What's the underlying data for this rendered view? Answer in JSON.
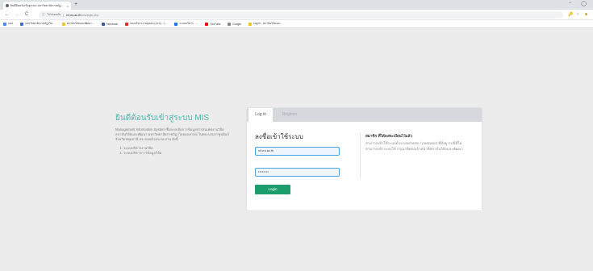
{
  "browser": {
    "tab": {
      "title": "ยินดีต้อนรับเข้าสู่ระบบ มหาวิทยาลัยราชภัฏ..."
    },
    "new_tab_glyph": "+",
    "window_controls": {
      "minimize": "−",
      "maximize": "◯"
    },
    "nav": {
      "back": "←",
      "forward": "→",
      "reload": "C"
    },
    "address": {
      "info_glyph": "ⓘ",
      "security_label": "ไม่ปลอดภัย",
      "separator": "|",
      "host": "rd.vru.ac.th",
      "path": "/mis/login.php"
    },
    "bookmarks": [
      {
        "label": "แอป",
        "color": "#4285f4"
      },
      {
        "label": "มหาวิทยาลัยราชภัฏวไล...",
        "color": "#3f6ad8"
      },
      {
        "label": "สถาบันวิจัยและพัฒนา...",
        "color": "#f1c232"
      },
      {
        "label": "Facebook",
        "color": "#3b5998"
      },
      {
        "label": "กองบริหารงานบุคคล (มรภ) - L...",
        "color": "#d93025"
      },
      {
        "label": "ระบบบริหาร - ...",
        "color": "#1a73e8"
      },
      {
        "label": "YouTube",
        "color": "#ff0000"
      },
      {
        "label": "Google",
        "color": "#888888"
      },
      {
        "label": "Log in - สถาบันวิจัยและ...",
        "color": "#f1c232"
      }
    ]
  },
  "intro": {
    "title": "ยินดีต้อนรับเข้าสู่ระบบ MIS",
    "description": "Management Information System ซึ่งระบบจัดการข้อมูลสารสนเทศงานวิจัยสถาบันวิจัยและพัฒนา มหาวิทยาลัยราชภัฏวไลยอลงกรณ์ ในพระบรมราชูปถัมภ์ จังหวัดปทุมธานี ประกอบด้วยระบบงาน ดังนี้",
    "items": [
      "ระบบบริหารงานวิจัย",
      "ระบบบริหารการข้อมูลวิจัย"
    ]
  },
  "login": {
    "tabs": {
      "login": "Log in",
      "register": "Register"
    },
    "title": "ลงชื่อเข้าใช้ระบบ",
    "username_value": "rd.vru.ac.th",
    "password_value": "••••••••",
    "button": "Login"
  },
  "register_info": {
    "title": "สมาชิก ที่ได้ลงทะเบียนไว้แล้ว",
    "text": "สามารถเข้าใช้ระบบด้วย username / password ที่มีอยู่ กรณีที่ไม่สามารถเข้าระบบได้ กรุณาติดต่อเจ้าหน้าที่สถาบันวิจัยและพัฒนา"
  },
  "toolbar_icons": [
    "🔑",
    "☆",
    "☻"
  ]
}
